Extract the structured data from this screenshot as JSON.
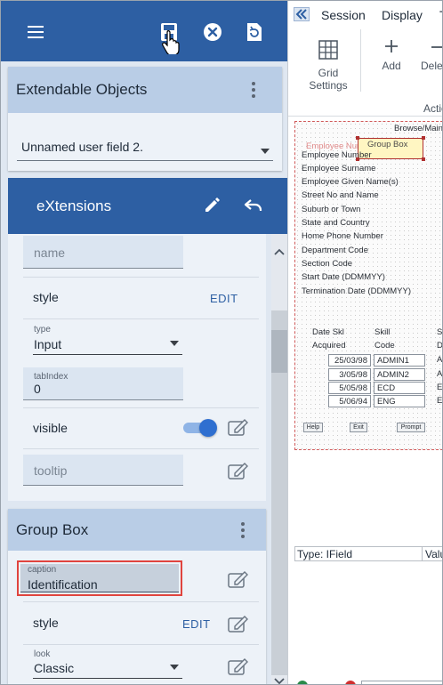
{
  "extendable": {
    "title": "Extendable Objects",
    "selected": "Unnamed user field 2."
  },
  "extensions": {
    "title": "eXtensions",
    "name_placeholder": "name",
    "style_label": "style",
    "edit_label": "EDIT",
    "type_label": "type",
    "type_value": "Input",
    "tabindex_label": "tabIndex",
    "tabindex_value": "0",
    "visible_label": "visible",
    "visible_on": true,
    "tooltip_placeholder": "tooltip"
  },
  "group_box": {
    "title": "Group Box",
    "caption_label": "caption",
    "caption_value": "Identification",
    "style_label": "style",
    "edit_label": "EDIT",
    "look_label": "look",
    "look_value": "Classic"
  },
  "right_panel": {
    "menu": [
      "Session",
      "Display",
      "T"
    ],
    "ribbon": {
      "grid_settings_line1": "Grid",
      "grid_settings_line2": "Settings",
      "add": "Add",
      "delete_partial": "Dele",
      "actions_partial": "Actio"
    },
    "canvas": {
      "header": "Browse/Main",
      "group_box_caption": "Group Box",
      "faded_label": "Employee Number",
      "fields": [
        "Employee Number",
        "Employee Surname",
        "Employee Given Name(s)",
        "Street No and Name",
        "Suburb or Town",
        "State and Country",
        "Home Phone Number",
        "Department Code",
        "Section Code",
        "Start Date (DDMMYY)",
        "Termination Date (DDMMYY)"
      ],
      "col1_header1": "Date Skl",
      "col1_header2": "Acquired",
      "col2_header1": "Skill",
      "col2_header2": "Code",
      "col3_header1": "Sk",
      "col3_header2": "De",
      "rows": [
        {
          "date": "25/03/98",
          "code": "ADMIN1",
          "d": "Ac"
        },
        {
          "date": "3/05/98",
          "code": "ADMIN2",
          "d": "Ac"
        },
        {
          "date": "5/05/98",
          "code": "ECD",
          "d": "Ec"
        },
        {
          "date": "5/06/94",
          "code": "ENG",
          "d": "En"
        }
      ],
      "help": "Help",
      "exit": "Exit",
      "prompt": "Prompt"
    },
    "property_type": "Type: IField",
    "property_value": "Valu"
  },
  "colors": {
    "header_blue": "#2d5fa3",
    "card_head": "#b9cde6",
    "highlight_red": "#e0443e",
    "toggle_blue": "#2f6fd0"
  }
}
